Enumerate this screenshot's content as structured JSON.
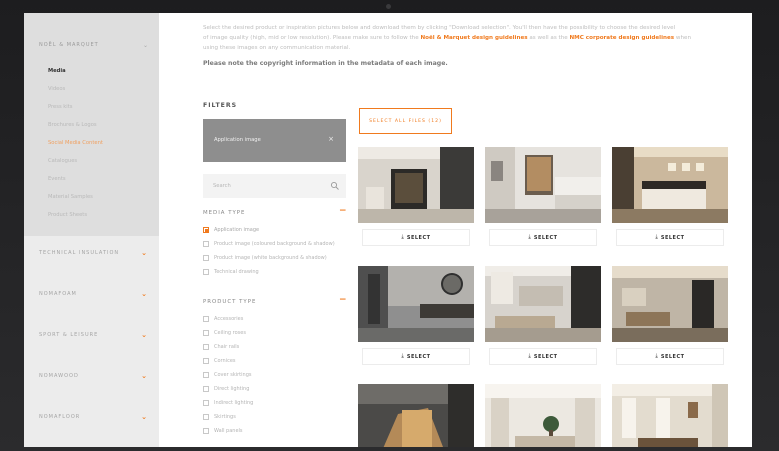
{
  "sidebar": {
    "header": "NOËL & MARQUET",
    "subitems": [
      {
        "label": "Media",
        "state": "active"
      },
      {
        "label": "Videos",
        "state": "muted"
      },
      {
        "label": "Press kits",
        "state": "muted"
      },
      {
        "label": "Brochures & Logos",
        "state": "muted"
      },
      {
        "label": "Social Media Content",
        "state": "orange"
      },
      {
        "label": "Catalogues",
        "state": "muted"
      },
      {
        "label": "Events",
        "state": "muted"
      },
      {
        "label": "Material Samples",
        "state": "muted"
      },
      {
        "label": "Product Sheets",
        "state": "muted"
      }
    ],
    "categories": [
      "TECHNICAL INSULATION",
      "NOMAFOAM",
      "SPORT & LEISURE",
      "NOMAWOOD",
      "NOMAFLOOR"
    ]
  },
  "intro": {
    "line1": "Select the desired product or inspiration pictures below and download them by clicking \"Download selection\". You'll then have the possibility to choose the desired level",
    "line2": "of image quality (high, mid or low resolution). Please make sure to follow the",
    "link1": "Noël & Marquet design guidelines",
    "between": "as well as the",
    "link2": "NMC corporate design guidelines",
    "after": "when",
    "line3": "using these images on any communication material.",
    "copyright": "Please note the copyright information in the metadata of each image."
  },
  "filters": {
    "title": "FILTERS",
    "dropdown_value": "Application image",
    "search_placeholder": "Search",
    "media_type": {
      "title": "MEDIA TYPE",
      "options": [
        {
          "label": "Application image",
          "checked": true
        },
        {
          "label": "Product image (coloured background & shadow)",
          "checked": false
        },
        {
          "label": "Product image (white background & shadow)",
          "checked": false
        },
        {
          "label": "Technical drawing",
          "checked": false
        }
      ]
    },
    "product_type": {
      "title": "PRODUCT TYPE",
      "options": [
        {
          "label": "Accessories",
          "checked": false
        },
        {
          "label": "Ceiling roses",
          "checked": false
        },
        {
          "label": "Chair rails",
          "checked": false
        },
        {
          "label": "Cornices",
          "checked": false
        },
        {
          "label": "Cover skirtings",
          "checked": false
        },
        {
          "label": "Direct lighting",
          "checked": false
        },
        {
          "label": "Indirect lighting",
          "checked": false
        },
        {
          "label": "Skirtings",
          "checked": false
        },
        {
          "label": "Wall panels",
          "checked": false
        }
      ]
    }
  },
  "gallery": {
    "select_all_label": "SELECT ALL FILES (12)",
    "select_label": "SELECT",
    "download_glyph": "⤓",
    "cards": [
      {
        "scene": "lounge-niche"
      },
      {
        "scene": "kitchen"
      },
      {
        "scene": "bedroom"
      },
      {
        "scene": "bathroom"
      },
      {
        "scene": "kitchen-dark"
      },
      {
        "scene": "living-room"
      },
      {
        "scene": "stair-wall"
      },
      {
        "scene": "bright-living"
      },
      {
        "scene": "dining-room"
      }
    ]
  },
  "icons": {
    "chevron": "⌄",
    "close": "×",
    "minus": "−",
    "search": "search-icon"
  },
  "colors": {
    "accent": "#f07a1e",
    "sidebar": "#ececec",
    "dropdown": "#8e8e8e"
  }
}
